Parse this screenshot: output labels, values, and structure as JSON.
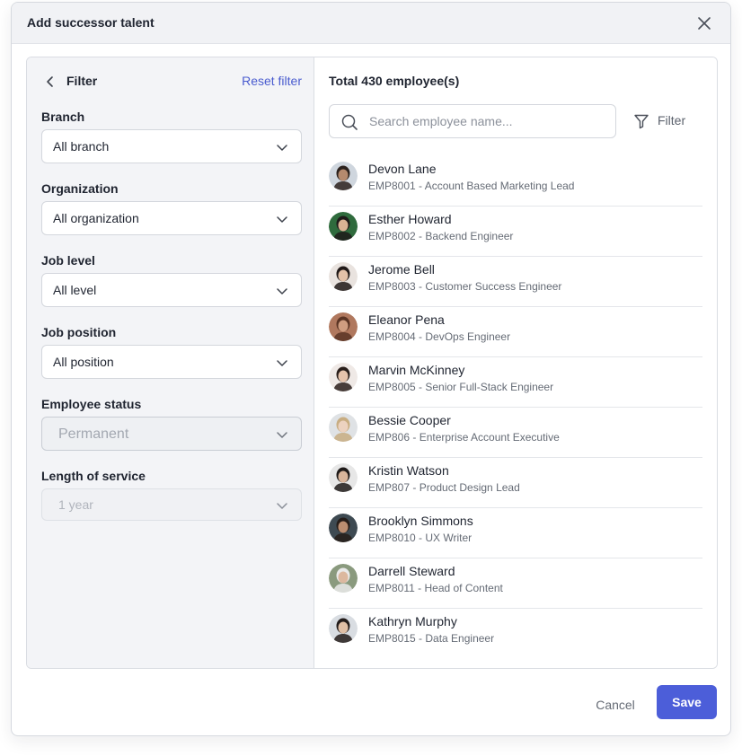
{
  "modal": {
    "title": "Add successor talent",
    "close_icon": "close-icon"
  },
  "filter": {
    "title": "Filter",
    "reset_label": "Reset filter",
    "fields": [
      {
        "label": "Branch",
        "value": "All branch",
        "disabled": false
      },
      {
        "label": "Organization",
        "value": "All organization",
        "disabled": false
      },
      {
        "label": "Job level",
        "value": "All level",
        "disabled": false
      },
      {
        "label": "Job position",
        "value": "All position",
        "disabled": false
      },
      {
        "label": "Employee status",
        "value": "Permanent",
        "disabled": true
      },
      {
        "label": "Length of service",
        "value": "1 year",
        "disabled": true
      }
    ]
  },
  "list": {
    "total": "Total 430 employee(s)",
    "search_placeholder": "Search employee name...",
    "filter_label": "Filter",
    "employees": [
      {
        "name": "Devon Lane",
        "sub": "EMP8001 - Account Based Marketing Lead",
        "skin": "#b58a6e",
        "hair": "#2b211d",
        "bg": "#cfd6de"
      },
      {
        "name": "Esther Howard",
        "sub": "EMP8002 - Backend Engineer",
        "skin": "#d9b294",
        "hair": "#1d1a19",
        "bg": "#2f6b3d"
      },
      {
        "name": "Jerome Bell",
        "sub": "EMP8003 - Customer Success Engineer",
        "skin": "#e3c1a8",
        "hair": "#201918",
        "bg": "#e9e3df"
      },
      {
        "name": "Eleanor Pena",
        "sub": "EMP8004 - DevOps Engineer",
        "skin": "#cf9d80",
        "hair": "#5a3424",
        "bg": "#b0785e"
      },
      {
        "name": "Marvin McKinney",
        "sub": "EMP8005 - Senior Full-Stack Engineer",
        "skin": "#e6c3ab",
        "hair": "#2a1f1b",
        "bg": "#efe9e6"
      },
      {
        "name": "Bessie Cooper",
        "sub": "EMP806 - Enterprise Account Executive",
        "skin": "#ecd2c0",
        "hair": "#c8ad82",
        "bg": "#dfe2e5"
      },
      {
        "name": "Kristin Watson",
        "sub": "EMP807 - Product Design Lead",
        "skin": "#d9b59b",
        "hair": "#1f1a19",
        "bg": "#e7e7e7"
      },
      {
        "name": "Brooklyn Simmons",
        "sub": "EMP8010 - UX Writer",
        "skin": "#bb8d70",
        "hair": "#261d19",
        "bg": "#3e4a52"
      },
      {
        "name": "Darrell Steward",
        "sub": "EMP8011 - Head of Content",
        "skin": "#dcb89f",
        "hair": "#eaeaea",
        "bg": "#8a9a7e"
      },
      {
        "name": "Kathryn Murphy",
        "sub": "EMP8015 - Data Engineer",
        "skin": "#e0bfa5",
        "hair": "#231c1a",
        "bg": "#d9dde2"
      }
    ]
  },
  "footer": {
    "cancel_label": "Cancel",
    "save_label": "Save"
  },
  "colors": {
    "accent": "#4c5ed9",
    "link": "#4a5ccf"
  }
}
